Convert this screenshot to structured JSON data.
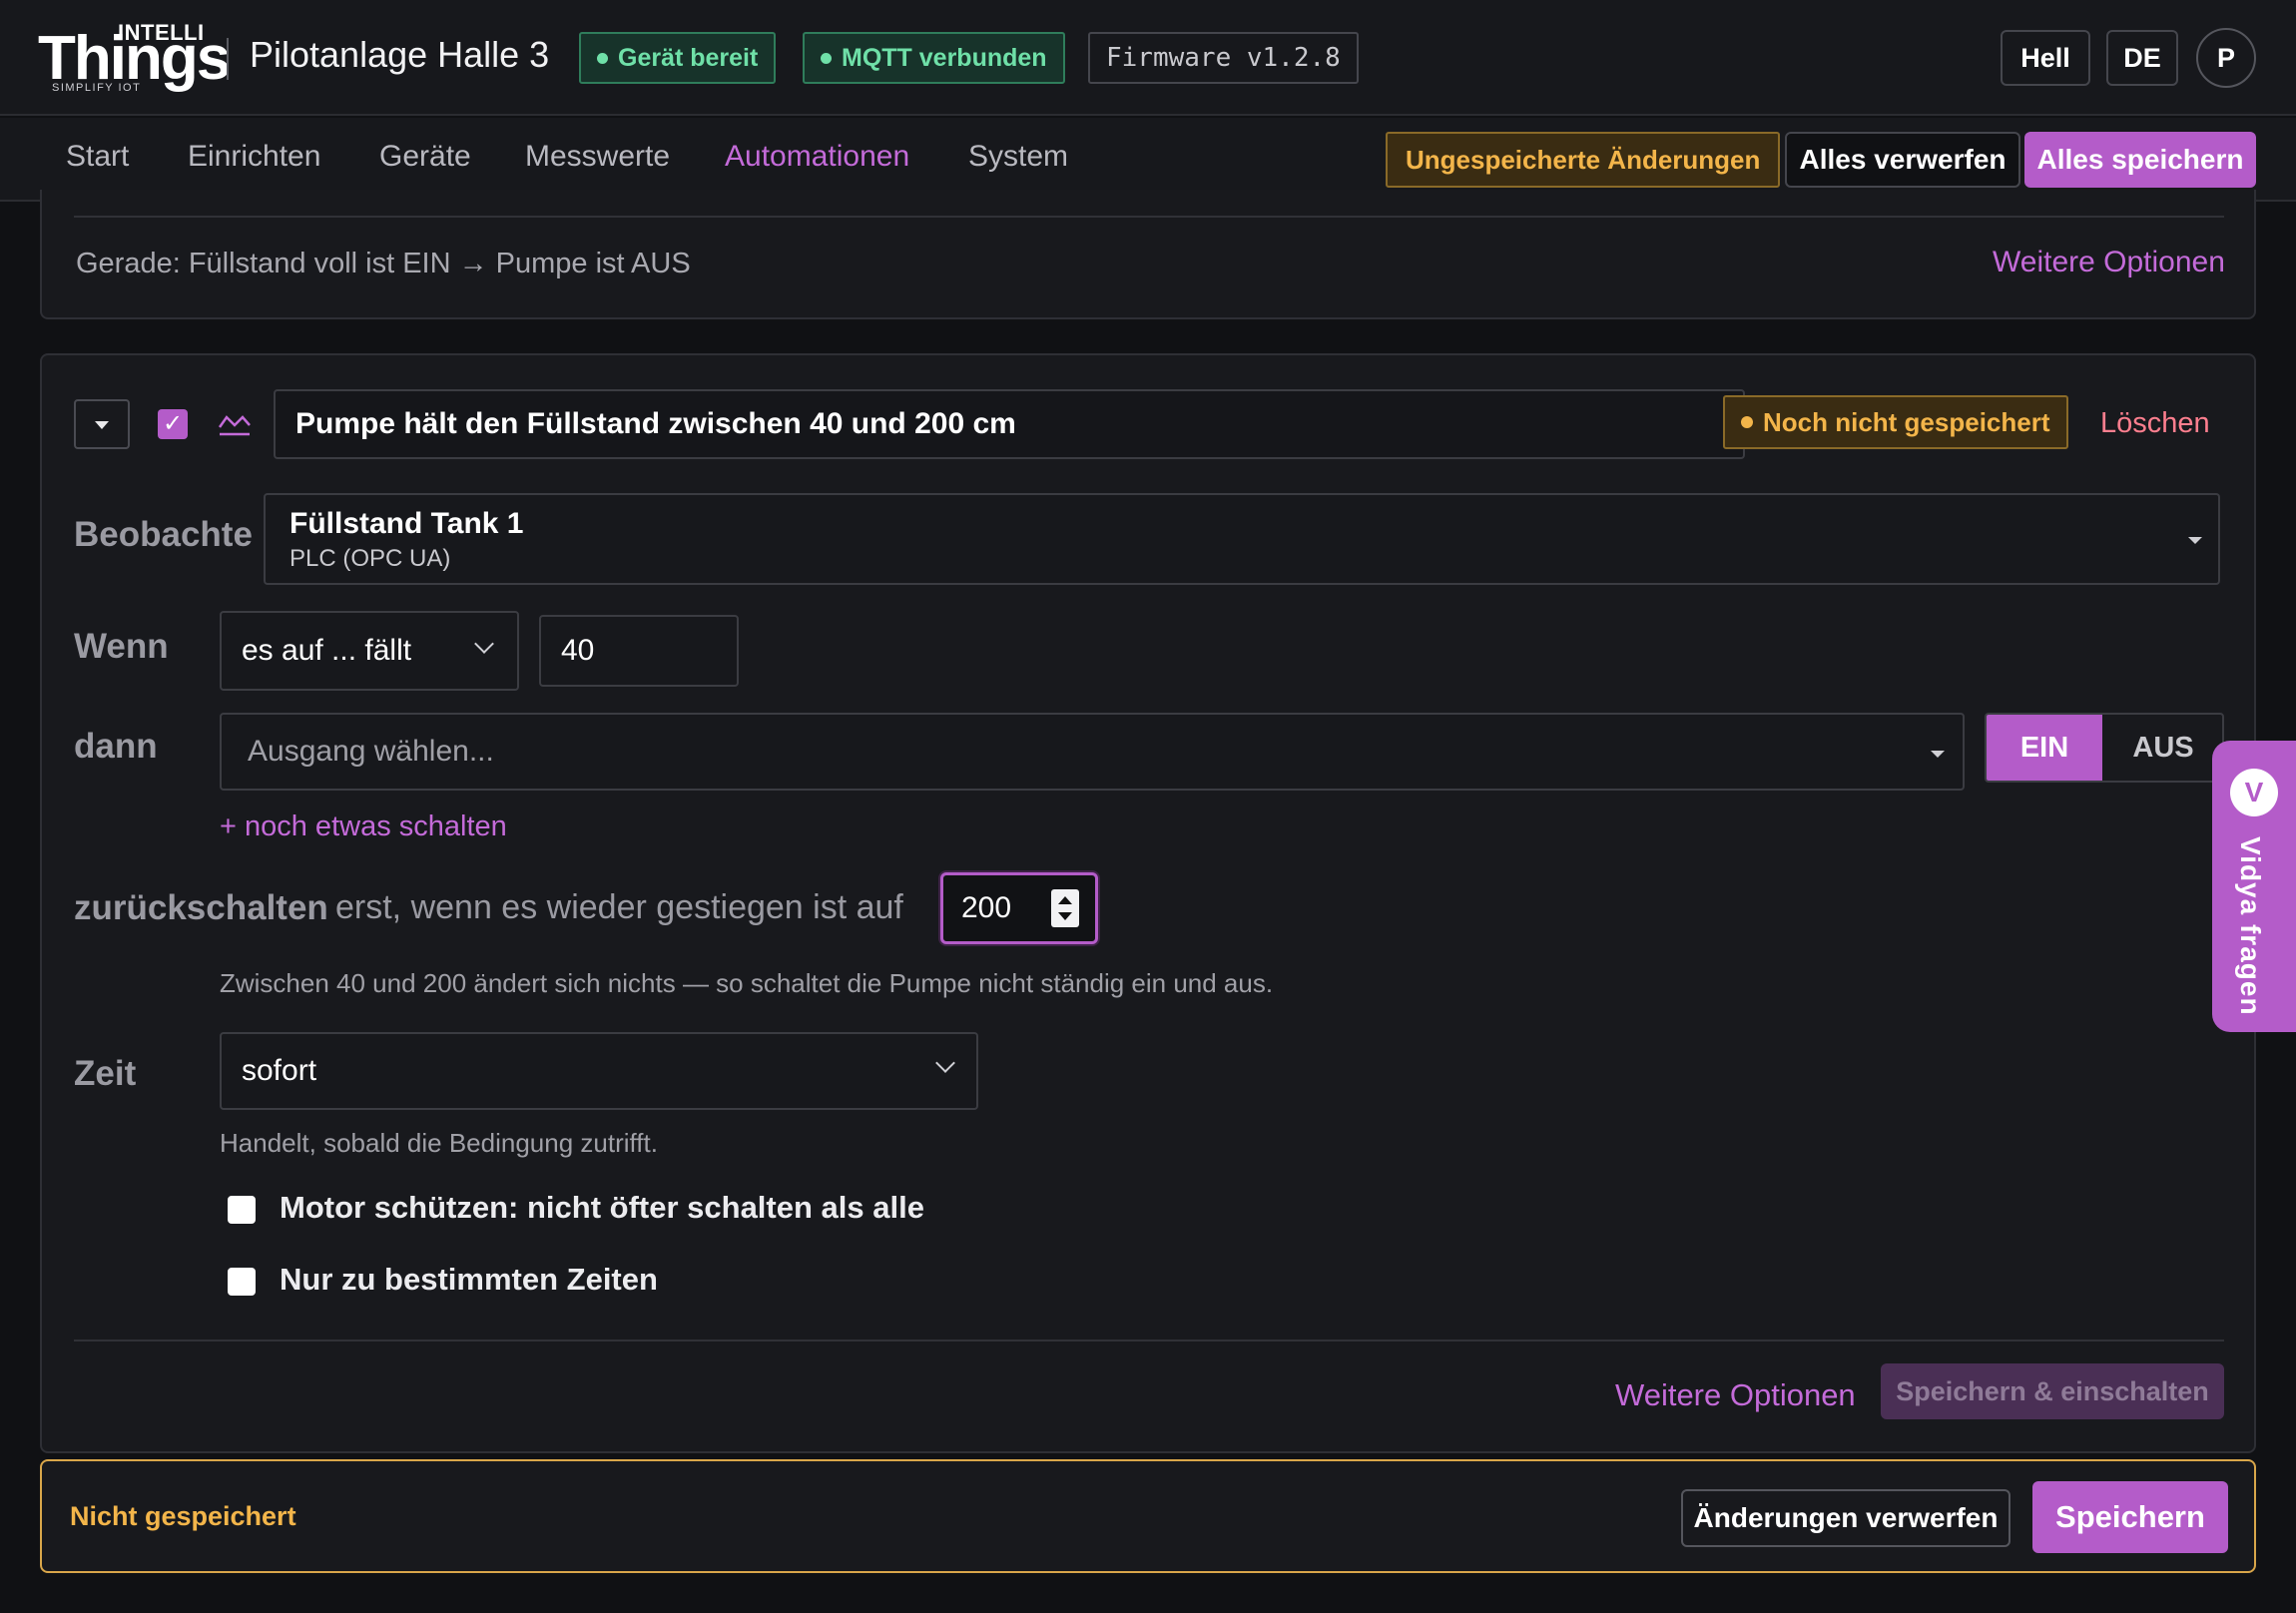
{
  "header": {
    "logo_top": "INTELLI",
    "logo_main": "Things",
    "logo_sub": "SIMPLIFY IOT",
    "site_name": "Pilotanlage Halle 3",
    "status_device": "Gerät bereit",
    "status_mqtt": "MQTT verbunden",
    "firmware": "Firmware v1.2.8",
    "theme_label": "Hell",
    "lang_label": "DE",
    "avatar_initial": "P"
  },
  "nav": {
    "tabs": [
      "Start",
      "Einrichten",
      "Geräte",
      "Messwerte",
      "Automationen",
      "System"
    ],
    "active_tab": "Automationen",
    "unsaved_label": "Ungespeicherte Änderungen",
    "discard_all": "Alles verwerfen",
    "save_all": "Alles speichern"
  },
  "prev_rule": {
    "summary": "Gerade: Füllstand voll ist EIN → Pumpe ist AUS",
    "more_options": "Weitere Optionen"
  },
  "rule": {
    "enabled": true,
    "title": "Pumpe hält den Füllstand zwischen 40 und 200 cm",
    "status": "Noch nicht gespeichert",
    "delete": "Löschen",
    "observe_label": "Beobachte",
    "observe_name": "Füllstand Tank 1",
    "observe_source": "PLC (OPC UA)",
    "when_label": "Wenn",
    "condition": "es auf ... fällt",
    "threshold": "40",
    "then_label": "dann",
    "output_placeholder": "Ausgang wählen...",
    "on_label": "EIN",
    "off_label": "AUS",
    "selected_state": "EIN",
    "add_more": "+ noch etwas schalten",
    "return_label": "zurückschalten",
    "return_text": "erst, wenn es wieder gestiegen ist auf",
    "return_value": "200",
    "hysteresis_hint": "Zwischen 40 und 200 ändert sich nichts — so schaltet die Pumpe nicht ständig ein und aus.",
    "time_label": "Zeit",
    "time_value": "sofort",
    "time_hint": "Handelt, sobald die Bedingung zutrifft.",
    "option_motor": "Motor schützen: nicht öfter schalten als alle",
    "option_times": "Nur zu bestimmten Zeiten",
    "more_options": "Weitere Optionen",
    "save_enable": "Speichern & einschalten"
  },
  "footer": {
    "status": "Nicht gespeichert",
    "discard": "Änderungen verwerfen",
    "save": "Speichern"
  },
  "assistant": {
    "initial": "V",
    "label": "Vidya fragen"
  },
  "colors": {
    "accent": "#b45cc9",
    "warning": "#f3b54a",
    "success": "#6fe0a8",
    "danger": "#ff7f8f"
  }
}
